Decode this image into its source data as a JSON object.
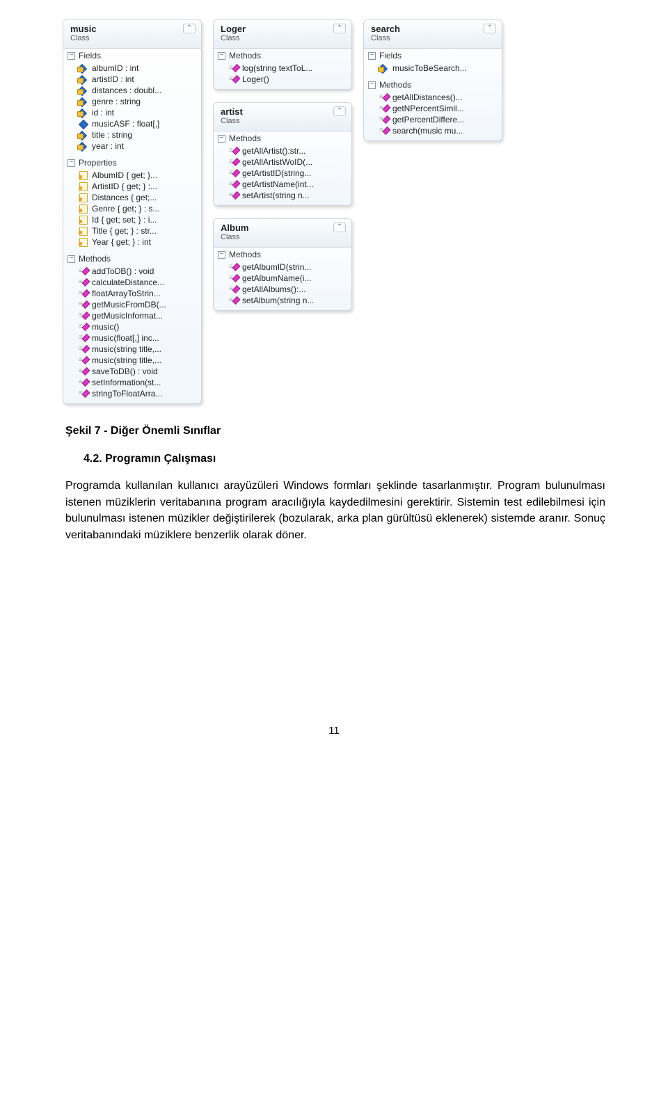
{
  "diagram": {
    "stereotype": "Class",
    "sectionLabels": {
      "fields": "Fields",
      "properties": "Properties",
      "methods": "Methods"
    },
    "col1": [
      {
        "name": "music",
        "sections": [
          {
            "type": "fields",
            "items": [
              {
                "icon": "field",
                "text": "albumID : int"
              },
              {
                "icon": "field",
                "text": "artistID : int"
              },
              {
                "icon": "field",
                "text": "distances : doubl..."
              },
              {
                "icon": "field",
                "text": "genre : string"
              },
              {
                "icon": "field",
                "text": "id : int"
              },
              {
                "icon": "field-pub",
                "text": "musicASF : float[,]"
              },
              {
                "icon": "field",
                "text": "title : string"
              },
              {
                "icon": "field",
                "text": "year : int"
              }
            ]
          },
          {
            "type": "properties",
            "items": [
              {
                "icon": "prop",
                "text": "AlbumID { get; }..."
              },
              {
                "icon": "prop",
                "text": "ArtistID { get; } :..."
              },
              {
                "icon": "prop",
                "text": "Distances { get;..."
              },
              {
                "icon": "prop",
                "text": "Genre { get; } : s..."
              },
              {
                "icon": "prop",
                "text": "Id { get; set; } : i..."
              },
              {
                "icon": "prop",
                "text": "Title { get; } : str..."
              },
              {
                "icon": "prop",
                "text": "Year { get; } : int"
              }
            ]
          },
          {
            "type": "methods",
            "items": [
              {
                "icon": "method",
                "text": "addToDB() : void"
              },
              {
                "icon": "method",
                "text": "calculateDistance..."
              },
              {
                "icon": "method",
                "text": "floatArrayToStrin..."
              },
              {
                "icon": "method",
                "text": "getMusicFromDB(..."
              },
              {
                "icon": "method",
                "text": "getMusicInformat..."
              },
              {
                "icon": "method",
                "text": "music()"
              },
              {
                "icon": "method",
                "text": "music(float[,] inc..."
              },
              {
                "icon": "method",
                "text": "music(string title,..."
              },
              {
                "icon": "method",
                "text": "music(string title,..."
              },
              {
                "icon": "method",
                "text": "saveToDB() : void"
              },
              {
                "icon": "method",
                "text": "setInformation(st..."
              },
              {
                "icon": "method",
                "text": "stringToFloatArra..."
              }
            ]
          }
        ]
      }
    ],
    "col2": [
      {
        "name": "Loger",
        "sections": [
          {
            "type": "methods",
            "items": [
              {
                "icon": "method",
                "text": "log(string textToL..."
              },
              {
                "icon": "method",
                "text": "Loger()"
              }
            ]
          }
        ]
      },
      {
        "name": "artist",
        "sections": [
          {
            "type": "methods",
            "items": [
              {
                "icon": "method",
                "text": "getAllArtist():str..."
              },
              {
                "icon": "method",
                "text": "getAllArtistWoID(..."
              },
              {
                "icon": "method",
                "text": "getArtistID(string..."
              },
              {
                "icon": "method",
                "text": "getArtistName(int..."
              },
              {
                "icon": "method",
                "text": "setArtist(string n..."
              }
            ]
          }
        ]
      },
      {
        "name": "Album",
        "sections": [
          {
            "type": "methods",
            "items": [
              {
                "icon": "method",
                "text": "getAlbumID(strin..."
              },
              {
                "icon": "method",
                "text": "getAlbumName(i..."
              },
              {
                "icon": "method",
                "text": "getAllAlbums():..."
              },
              {
                "icon": "method",
                "text": "setAlbum(string n..."
              }
            ]
          }
        ]
      }
    ],
    "col3": [
      {
        "name": "search",
        "sections": [
          {
            "type": "fields",
            "items": [
              {
                "icon": "field",
                "text": "musicToBeSearch..."
              }
            ]
          },
          {
            "type": "methods",
            "items": [
              {
                "icon": "method",
                "text": "getAllDistances()..."
              },
              {
                "icon": "method",
                "text": "getNPercentSimil..."
              },
              {
                "icon": "method",
                "text": "getPercentDiffere..."
              },
              {
                "icon": "method",
                "text": "search(music mu..."
              }
            ]
          }
        ]
      }
    ]
  },
  "caption": "Şekil 7 - Diğer Önemli Sınıflar",
  "sectionNumber": "4.2.   Programın Çalışması",
  "body": "Programda kullanılan kullanıcı arayüzüleri Windows formları şeklinde tasarlanmıştır. Program bulunulması istenen müziklerin veritabanına program aracılığıyla kaydedilmesini gerektirir. Sistemin test edilebilmesi için bulunulması istenen müzikler değiştirilerek (bozularak, arka plan gürültüsü eklenerek) sistemde aranır. Sonuç veritabanındaki müziklere benzerlik olarak döner.",
  "pageNumber": "11"
}
